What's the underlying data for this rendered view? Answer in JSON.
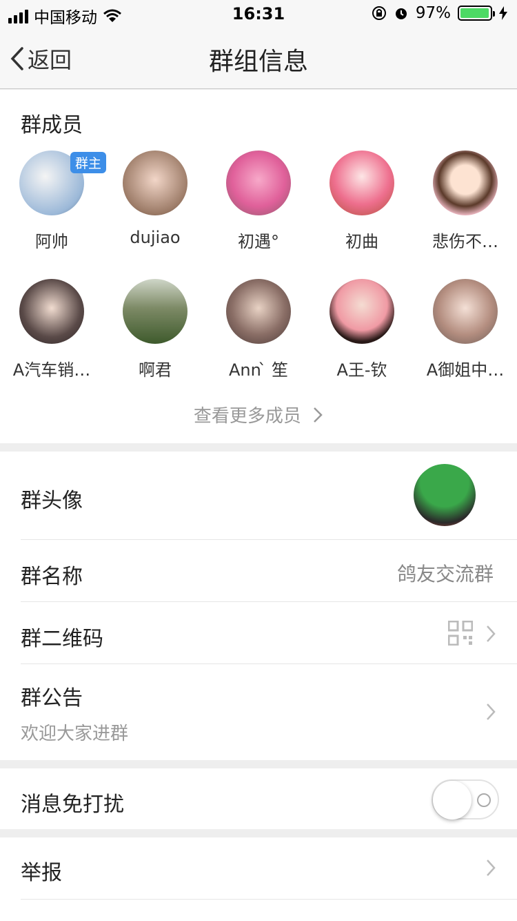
{
  "status_bar": {
    "carrier": "中国移动",
    "time": "16:31",
    "battery": "97%",
    "battery_level": 0.97,
    "battery_color": "#4cd964"
  },
  "nav": {
    "back_label": "返回",
    "title": "群组信息"
  },
  "members": {
    "title": "群成员",
    "owner_badge": "群主",
    "more_label": "查看更多成员",
    "items": [
      {
        "name": "阿帅"
      },
      {
        "name": "dujiao"
      },
      {
        "name": "初遇°"
      },
      {
        "name": "初曲"
      },
      {
        "name": "悲伤不…"
      },
      {
        "name": "A汽车销…"
      },
      {
        "name": "啊君"
      },
      {
        "name": "Ann ̀  笙"
      },
      {
        "name": "A王-钦"
      },
      {
        "name": "A御姐中…"
      }
    ]
  },
  "settings": {
    "avatar_label": "群头像",
    "name_label": "群名称",
    "name_value": "鸽友交流群",
    "qr_label": "群二维码",
    "notice_label": "群公告",
    "notice_value": "欢迎大家进群",
    "mute_label": "消息免打扰",
    "mute_on": false,
    "report_label": "举报"
  }
}
